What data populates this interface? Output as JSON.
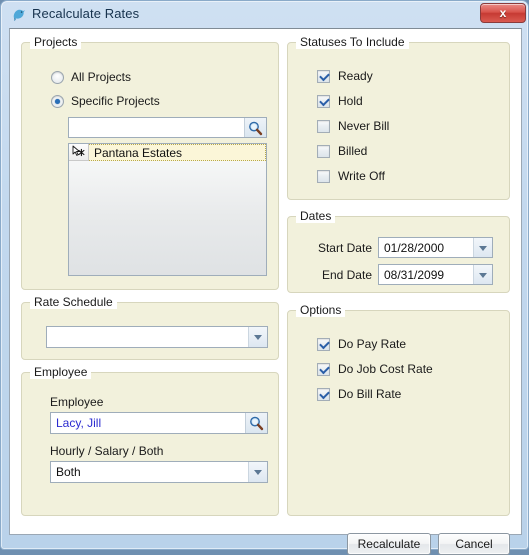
{
  "window": {
    "title": "Recalculate Rates",
    "icon": "bird-icon",
    "close_label": "x"
  },
  "projects": {
    "legend": "Projects",
    "radios": [
      {
        "label": "All Projects",
        "selected": false
      },
      {
        "label": "Specific Projects",
        "selected": true
      }
    ],
    "search": {
      "value": "",
      "placeholder": "",
      "icon": "magnifier-icon"
    },
    "list": {
      "rows": [
        {
          "label": "Pantana Estates",
          "indicator": "new-row-asterisk-icon"
        }
      ]
    }
  },
  "rate_schedule": {
    "legend": "Rate Schedule",
    "value": "",
    "placeholder": ""
  },
  "employee": {
    "legend": "Employee",
    "employee_label": "Employee",
    "employee_value": "Lacy, Jill",
    "employee_icon": "magnifier-icon",
    "type_label": "Hourly / Salary / Both",
    "type_value": "Both"
  },
  "statuses": {
    "legend": "Statuses To Include",
    "items": [
      {
        "label": "Ready",
        "checked": true
      },
      {
        "label": "Hold",
        "checked": true
      },
      {
        "label": "Never Bill",
        "checked": false
      },
      {
        "label": "Billed",
        "checked": false
      },
      {
        "label": "Write Off",
        "checked": false
      }
    ]
  },
  "dates": {
    "legend": "Dates",
    "start_label": "Start Date",
    "start_value": "01/28/2000",
    "end_label": "End Date",
    "end_value": "08/31/2099"
  },
  "options": {
    "legend": "Options",
    "items": [
      {
        "label": "Do Pay Rate",
        "checked": true
      },
      {
        "label": "Do Job Cost Rate",
        "checked": true
      },
      {
        "label": "Do Bill Rate",
        "checked": true
      }
    ]
  },
  "footer": {
    "recalculate_label": "Recalculate",
    "cancel_label": "Cancel"
  },
  "colors": {
    "group_bg": "#f2f1dc",
    "client_bg": "#ffffff",
    "titlebar": "#c2d8ee",
    "close_button": "#c63a33",
    "link_text": "#2b2bd0",
    "selected_row": "#fbf6d8",
    "accent_check": "#2b5fa8"
  }
}
